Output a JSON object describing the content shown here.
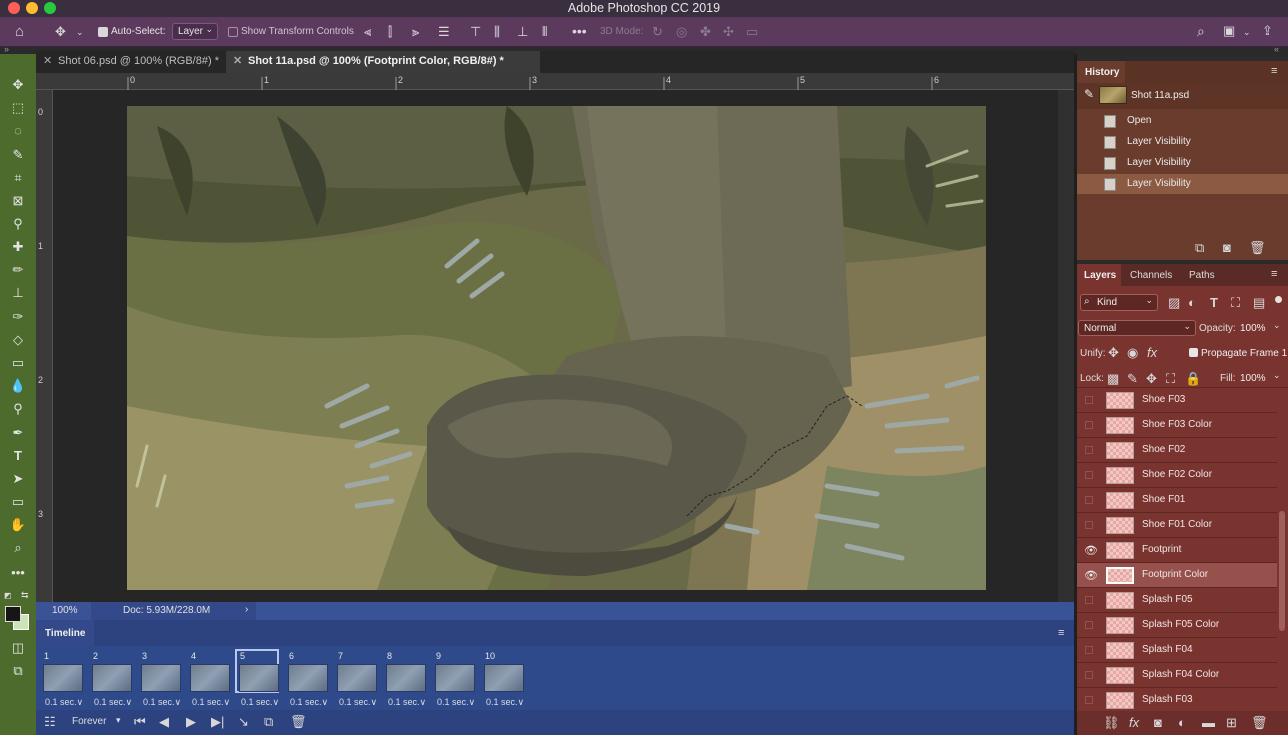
{
  "window": {
    "title": "Adobe Photoshop CC 2019"
  },
  "options_bar": {
    "auto_select_label": "Auto-Select:",
    "auto_select_value": "Layer",
    "show_transform_label": "Show Transform Controls",
    "mode_label": "3D Mode:"
  },
  "tabs": [
    {
      "label": "Shot 06.psd @ 100% (RGB/8#) *"
    },
    {
      "label": "Shot 11a.psd @ 100% (Footprint Color, RGB/8#) *"
    }
  ],
  "ruler_top": [
    "0",
    "1",
    "2",
    "3",
    "4",
    "5",
    "6"
  ],
  "ruler_left": [
    "0",
    "1",
    "2",
    "3"
  ],
  "status": {
    "zoom": "100%",
    "doc": "Doc: 5.93M/228.0M"
  },
  "timeline": {
    "title": "Timeline",
    "loop": "Forever",
    "frames": [
      {
        "num": "1",
        "dur": "0.1 sec.∨"
      },
      {
        "num": "2",
        "dur": "0.1 sec.∨"
      },
      {
        "num": "3",
        "dur": "0.1 sec.∨"
      },
      {
        "num": "4",
        "dur": "0.1 sec.∨"
      },
      {
        "num": "5",
        "dur": "0.1 sec.∨"
      },
      {
        "num": "6",
        "dur": "0.1 sec.∨"
      },
      {
        "num": "7",
        "dur": "0.1 sec.∨"
      },
      {
        "num": "8",
        "dur": "0.1 sec.∨"
      },
      {
        "num": "9",
        "dur": "0.1 sec.∨"
      },
      {
        "num": "10",
        "dur": "0.1 sec.∨"
      }
    ],
    "selected_frame": 5
  },
  "history": {
    "title": "History",
    "snapshot": "Shot 11a.psd",
    "items": [
      "Open",
      "Layer Visibility",
      "Layer Visibility",
      "Layer Visibility"
    ]
  },
  "layers_panel": {
    "tabs": [
      "Layers",
      "Channels",
      "Paths"
    ],
    "kind": "Kind",
    "blend": "Normal",
    "opacity_label": "Opacity:",
    "opacity": "100%",
    "unify_label": "Unify:",
    "propagate_label": "Propagate Frame 1",
    "lock_label": "Lock:",
    "fill_label": "Fill:",
    "fill": "100%",
    "layers": [
      {
        "name": "Shoe F03",
        "visible": false
      },
      {
        "name": "Shoe F03 Color",
        "visible": false
      },
      {
        "name": "Shoe F02",
        "visible": false
      },
      {
        "name": "Shoe F02 Color",
        "visible": false
      },
      {
        "name": "Shoe F01",
        "visible": false
      },
      {
        "name": "Shoe F01 Color",
        "visible": false
      },
      {
        "name": "Footprint",
        "visible": true
      },
      {
        "name": "Footprint Color",
        "visible": true,
        "selected": true
      },
      {
        "name": "Splash F05",
        "visible": false
      },
      {
        "name": "Splash F05 Color",
        "visible": false
      },
      {
        "name": "Splash F04",
        "visible": false
      },
      {
        "name": "Splash F04 Color",
        "visible": false
      },
      {
        "name": "Splash F03",
        "visible": false
      }
    ]
  },
  "colors": {
    "options_bar": "#5c3a5e",
    "toolbar": "#4d6b2d",
    "history_panel": "#6a3c2d",
    "layers_panel": "#7a3430",
    "timeline": "#2f4a8a"
  }
}
